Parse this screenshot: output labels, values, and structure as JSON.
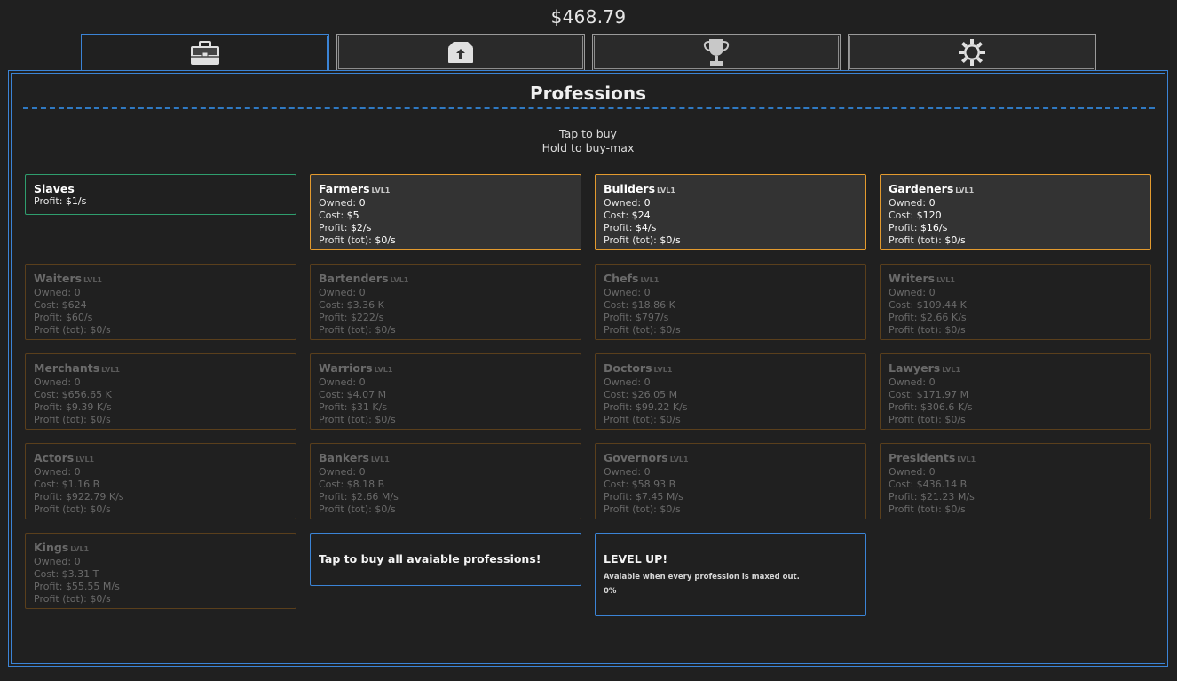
{
  "header": {
    "money": "$468.79"
  },
  "tabs": [
    {
      "icon": "briefcase-icon",
      "active": true
    },
    {
      "icon": "upgrade-box-icon",
      "active": false
    },
    {
      "icon": "trophy-icon",
      "active": false
    },
    {
      "icon": "settings-gear-icon",
      "active": false
    }
  ],
  "panel": {
    "title": "Professions",
    "hint_line1": "Tap to buy",
    "hint_line2": "Hold to buy-max"
  },
  "labels": {
    "owned": "Owned:",
    "cost": "Cost:",
    "profit": "Profit:",
    "profit_tot": "Profit (tot):"
  },
  "slaves": {
    "name": "Slaves",
    "profit_label": "Profit:",
    "profit": "$1/s"
  },
  "professions": [
    {
      "name": "Farmers",
      "level": "LVL1",
      "owned": "0",
      "cost": "$5",
      "profit": "$2/s",
      "profit_tot": "$0/s",
      "available": true
    },
    {
      "name": "Builders",
      "level": "LVL1",
      "owned": "0",
      "cost": "$24",
      "profit": "$4/s",
      "profit_tot": "$0/s",
      "available": true
    },
    {
      "name": "Gardeners",
      "level": "LVL1",
      "owned": "0",
      "cost": "$120",
      "profit": "$16/s",
      "profit_tot": "$0/s",
      "available": true
    },
    {
      "name": "Waiters",
      "level": "LVL1",
      "owned": "0",
      "cost": "$624",
      "profit": "$60/s",
      "profit_tot": "$0/s",
      "available": false
    },
    {
      "name": "Bartenders",
      "level": "LVL1",
      "owned": "0",
      "cost": "$3.36 K",
      "profit": "$222/s",
      "profit_tot": "$0/s",
      "available": false
    },
    {
      "name": "Chefs",
      "level": "LVL1",
      "owned": "0",
      "cost": "$18.86 K",
      "profit": "$797/s",
      "profit_tot": "$0/s",
      "available": false
    },
    {
      "name": "Writers",
      "level": "LVL1",
      "owned": "0",
      "cost": "$109.44 K",
      "profit": "$2.66 K/s",
      "profit_tot": "$0/s",
      "available": false
    },
    {
      "name": "Merchants",
      "level": "LVL1",
      "owned": "0",
      "cost": "$656.65 K",
      "profit": "$9.39 K/s",
      "profit_tot": "$0/s",
      "available": false
    },
    {
      "name": "Warriors",
      "level": "LVL1",
      "owned": "0",
      "cost": "$4.07 M",
      "profit": "$31 K/s",
      "profit_tot": "$0/s",
      "available": false
    },
    {
      "name": "Doctors",
      "level": "LVL1",
      "owned": "0",
      "cost": "$26.05 M",
      "profit": "$99.22 K/s",
      "profit_tot": "$0/s",
      "available": false
    },
    {
      "name": "Lawyers",
      "level": "LVL1",
      "owned": "0",
      "cost": "$171.97 M",
      "profit": "$306.6 K/s",
      "profit_tot": "$0/s",
      "available": false
    },
    {
      "name": "Actors",
      "level": "LVL1",
      "owned": "0",
      "cost": "$1.16 B",
      "profit": "$922.79 K/s",
      "profit_tot": "$0/s",
      "available": false
    },
    {
      "name": "Bankers",
      "level": "LVL1",
      "owned": "0",
      "cost": "$8.18 B",
      "profit": "$2.66 M/s",
      "profit_tot": "$0/s",
      "available": false
    },
    {
      "name": "Governors",
      "level": "LVL1",
      "owned": "0",
      "cost": "$58.93 B",
      "profit": "$7.45 M/s",
      "profit_tot": "$0/s",
      "available": false
    },
    {
      "name": "Presidents",
      "level": "LVL1",
      "owned": "0",
      "cost": "$436.14 B",
      "profit": "$21.23 M/s",
      "profit_tot": "$0/s",
      "available": false
    },
    {
      "name": "Kings",
      "level": "LVL1",
      "owned": "0",
      "cost": "$3.31 T",
      "profit": "$55.55 M/s",
      "profit_tot": "$0/s",
      "available": false
    }
  ],
  "buy_all": {
    "label": "Tap to buy all avaiable professions!"
  },
  "level_up": {
    "title": "LEVEL UP!",
    "description": "Avaiable when every profession is maxed out.",
    "progress": "0%"
  },
  "colors": {
    "accent_blue": "#3b84d6",
    "available_orange": "#e39a2e",
    "locked_brown": "#5a3f1c",
    "slaves_green": "#2f9e6e",
    "background": "#202020"
  }
}
